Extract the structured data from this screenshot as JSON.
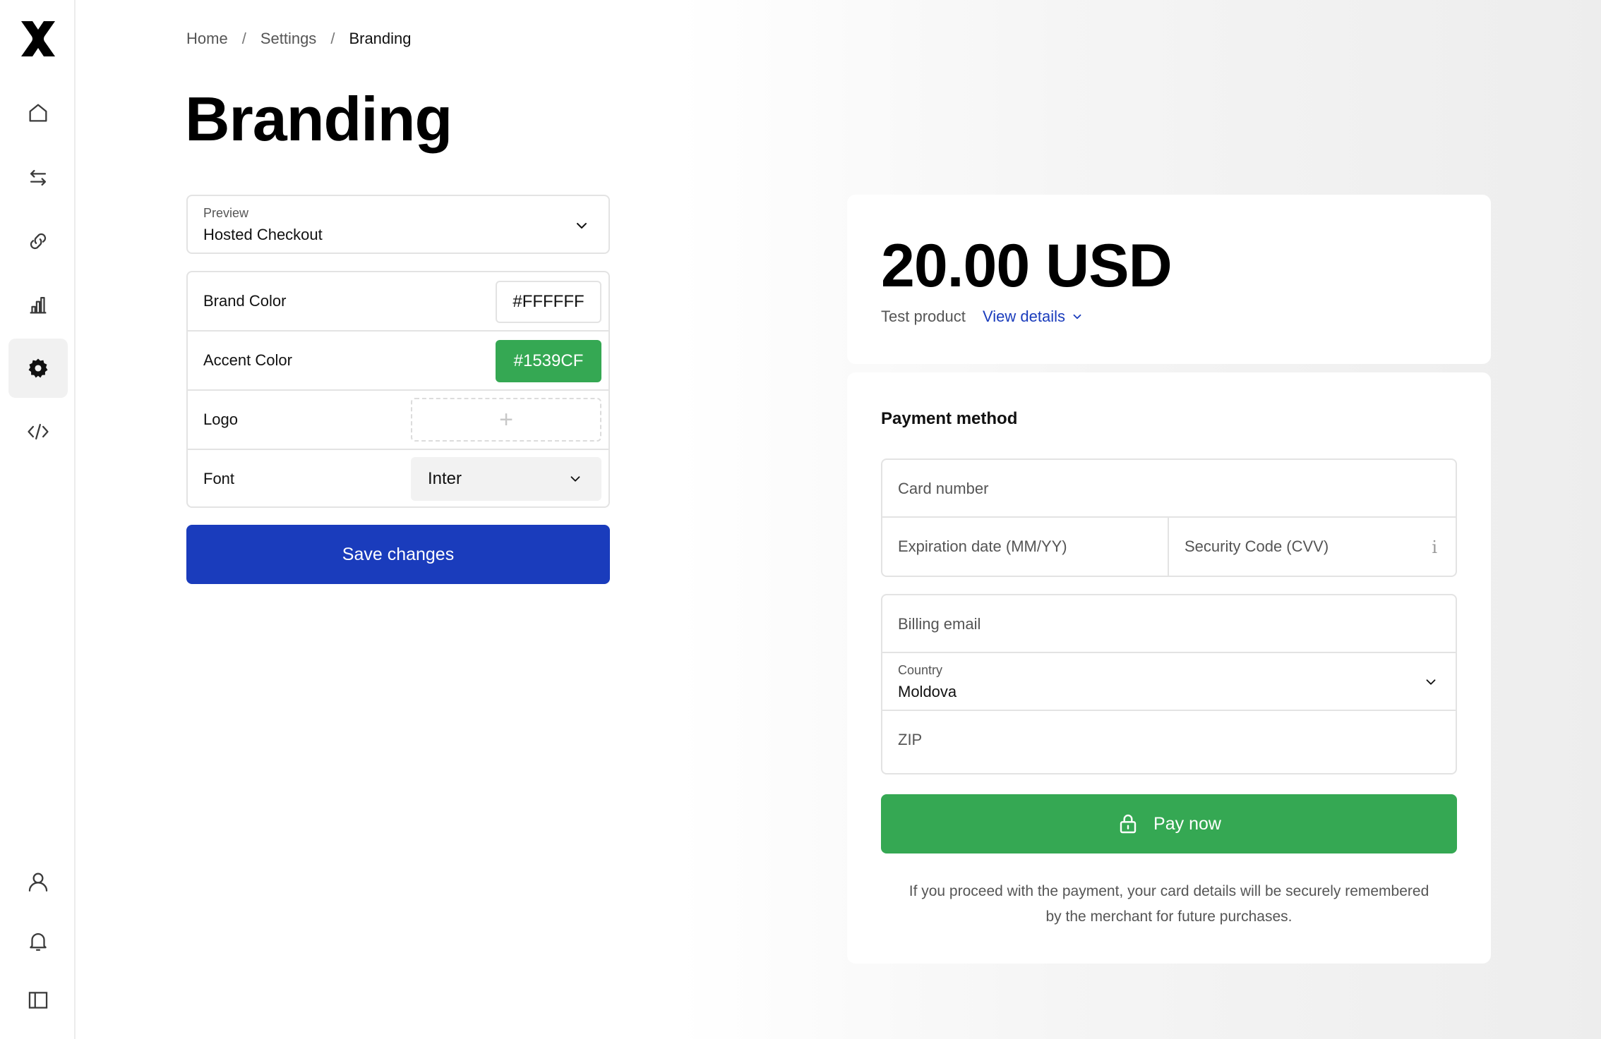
{
  "sidebar": {
    "logo_icon": "brand-x-logo",
    "top_items": [
      {
        "icon": "home-icon",
        "active": false
      },
      {
        "icon": "transactions-icon",
        "active": false
      },
      {
        "icon": "link-icon",
        "active": false
      },
      {
        "icon": "analytics-icon",
        "active": false
      },
      {
        "icon": "settings-icon",
        "active": true
      },
      {
        "icon": "code-icon",
        "active": false
      }
    ],
    "bottom_items": [
      {
        "icon": "user-icon"
      },
      {
        "icon": "bell-icon"
      },
      {
        "icon": "sidebar-toggle-icon"
      }
    ]
  },
  "breadcrumb": {
    "home": "Home",
    "separator": "/",
    "settings": "Settings",
    "current": "Branding"
  },
  "page_title": "Branding",
  "preview": {
    "label": "Preview",
    "value": "Hosted Checkout"
  },
  "settings": {
    "brand_color_label": "Brand Color",
    "brand_color_value": "#FFFFFF",
    "accent_color_label": "Accent Color",
    "accent_color_value": "#1539CF",
    "logo_label": "Logo",
    "logo_add": "+",
    "font_label": "Font",
    "font_value": "Inter",
    "save_label": "Save changes"
  },
  "checkout": {
    "amount": "20.00 USD",
    "product": "Test product",
    "view_details": "View details",
    "payment_method": "Payment method",
    "card_number": "Card number",
    "expiration": "Expiration date (MM/YY)",
    "security_code": "Security Code (CVV)",
    "billing_email": "Billing email",
    "country_label": "Country",
    "country_value": "Moldova",
    "zip": "ZIP",
    "pay_now": "Pay now",
    "disclaimer_line1": "If you proceed with the payment, your card details will be securely remembered",
    "disclaimer_line2": "by the merchant for future purchases."
  },
  "colors": {
    "primary_button": "#1A3CBC",
    "accent_green": "#35A853",
    "link_blue": "#1A3CBC"
  }
}
